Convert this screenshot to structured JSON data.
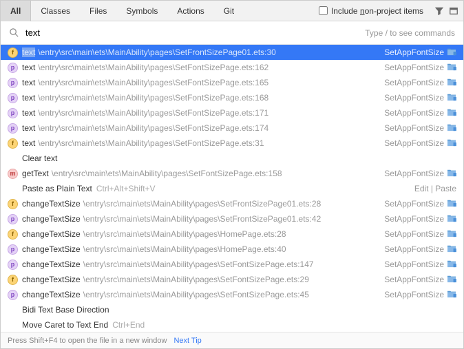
{
  "tabs": {
    "items": [
      "All",
      "Classes",
      "Files",
      "Symbols",
      "Actions",
      "Git"
    ],
    "active": 0
  },
  "toolbar": {
    "include_label_pre": "Include ",
    "include_label_ul": "n",
    "include_label_post": "on-project items"
  },
  "search": {
    "value": "text",
    "hint": "Type / to see commands"
  },
  "results": [
    {
      "kind": "f",
      "sym": "text",
      "path": "\\entry\\src\\main\\ets\\MainAbility\\pages\\SetFrontSizePage01.ets:30",
      "right": "SetAppFontSize",
      "folder": true,
      "selected": true,
      "highlight": true
    },
    {
      "kind": "p",
      "sym": "text",
      "path": "\\entry\\src\\main\\ets\\MainAbility\\pages\\SetFontSizePage.ets:162",
      "right": "SetAppFontSize",
      "folder": true
    },
    {
      "kind": "p",
      "sym": "text",
      "path": "\\entry\\src\\main\\ets\\MainAbility\\pages\\SetFontSizePage.ets:165",
      "right": "SetAppFontSize",
      "folder": true
    },
    {
      "kind": "p",
      "sym": "text",
      "path": "\\entry\\src\\main\\ets\\MainAbility\\pages\\SetFontSizePage.ets:168",
      "right": "SetAppFontSize",
      "folder": true
    },
    {
      "kind": "p",
      "sym": "text",
      "path": "\\entry\\src\\main\\ets\\MainAbility\\pages\\SetFontSizePage.ets:171",
      "right": "SetAppFontSize",
      "folder": true
    },
    {
      "kind": "p",
      "sym": "text",
      "path": "\\entry\\src\\main\\ets\\MainAbility\\pages\\SetFontSizePage.ets:174",
      "right": "SetAppFontSize",
      "folder": true
    },
    {
      "kind": "f",
      "sym": "text",
      "path": "\\entry\\src\\main\\ets\\MainAbility\\pages\\SetFontSizePage.ets:31",
      "right": "SetAppFontSize",
      "folder": true
    },
    {
      "kind": "none",
      "sym": "Clear text"
    },
    {
      "kind": "m",
      "sym": "getText",
      "path": "\\entry\\src\\main\\ets\\MainAbility\\pages\\SetFontSizePage.ets:158",
      "right": "SetAppFontSize",
      "folder": true
    },
    {
      "kind": "none",
      "sym": "Paste as Plain Text",
      "shortcut": "Ctrl+Alt+Shift+V",
      "right": "Edit | Paste"
    },
    {
      "kind": "f",
      "sym": "changeTextSize",
      "path": "\\entry\\src\\main\\ets\\MainAbility\\pages\\SetFrontSizePage01.ets:28",
      "right": "SetAppFontSize",
      "folder": true
    },
    {
      "kind": "p",
      "sym": "changeTextSize",
      "path": "\\entry\\src\\main\\ets\\MainAbility\\pages\\SetFrontSizePage01.ets:42",
      "right": "SetAppFontSize",
      "folder": true
    },
    {
      "kind": "f",
      "sym": "changeTextSize",
      "path": "\\entry\\src\\main\\ets\\MainAbility\\pages\\HomePage.ets:28",
      "right": "SetAppFontSize",
      "folder": true
    },
    {
      "kind": "p",
      "sym": "changeTextSize",
      "path": "\\entry\\src\\main\\ets\\MainAbility\\pages\\HomePage.ets:40",
      "right": "SetAppFontSize",
      "folder": true
    },
    {
      "kind": "p",
      "sym": "changeTextSize",
      "path": "\\entry\\src\\main\\ets\\MainAbility\\pages\\SetFontSizePage.ets:147",
      "right": "SetAppFontSize",
      "folder": true
    },
    {
      "kind": "f",
      "sym": "changeTextSize",
      "path": "\\entry\\src\\main\\ets\\MainAbility\\pages\\SetFontSizePage.ets:29",
      "right": "SetAppFontSize",
      "folder": true
    },
    {
      "kind": "p",
      "sym": "changeTextSize",
      "path": "\\entry\\src\\main\\ets\\MainAbility\\pages\\SetFontSizePage.ets:45",
      "right": "SetAppFontSize",
      "folder": true
    },
    {
      "kind": "none",
      "sym": "Bidi Text Base Direction"
    },
    {
      "kind": "none",
      "sym": "Move Caret to Text End",
      "shortcut": "Ctrl+End"
    }
  ],
  "footer": {
    "tip": "Press Shift+F4 to open the file in a new window",
    "link": "Next Tip"
  }
}
